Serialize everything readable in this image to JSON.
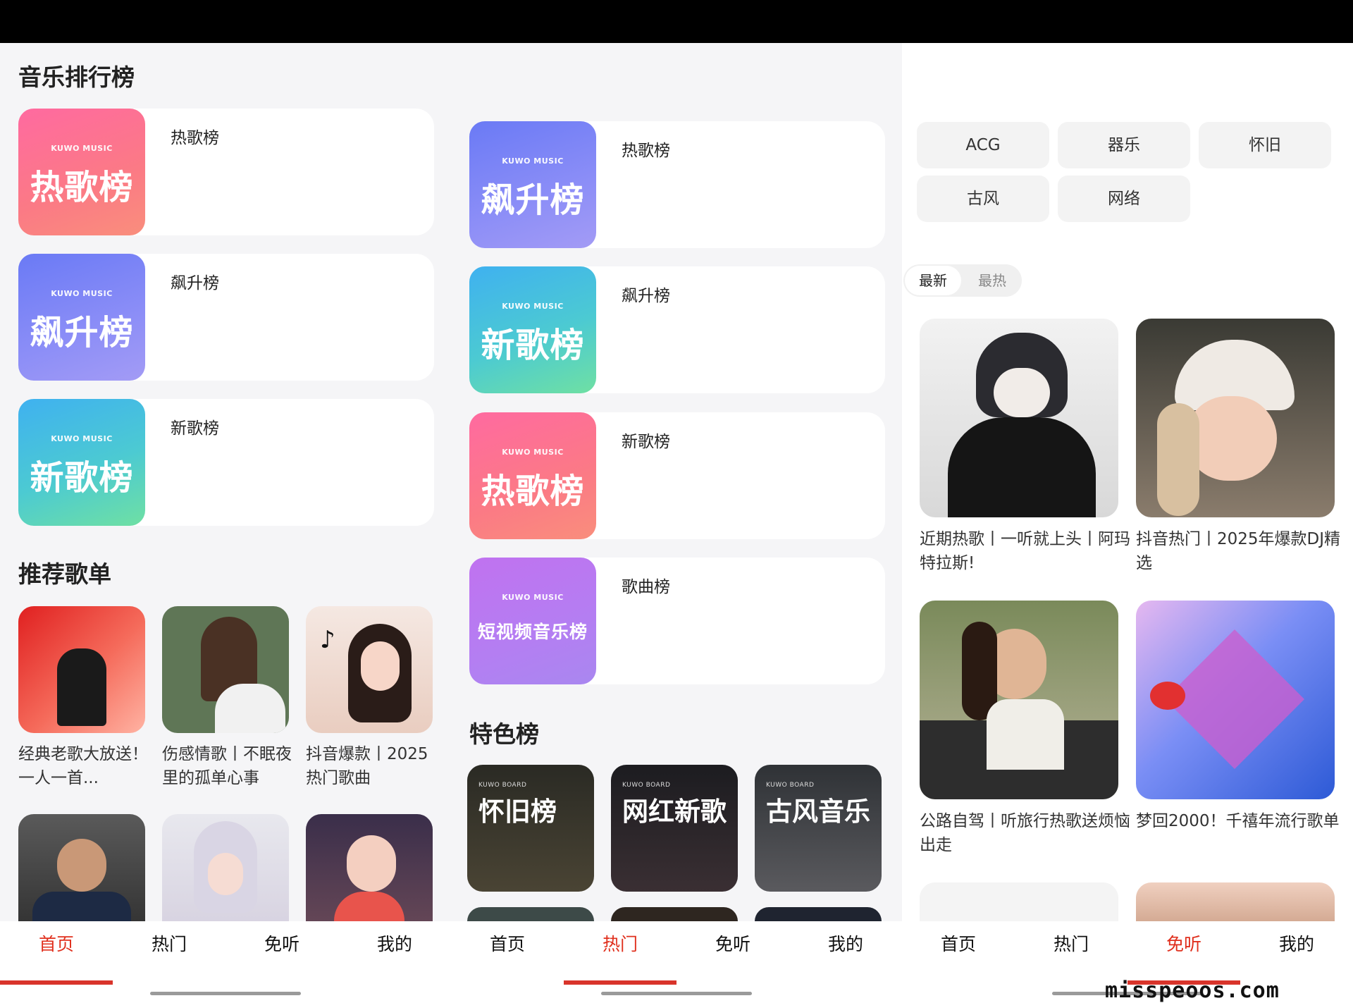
{
  "panel1": {
    "rank_title": "音乐排行榜",
    "rank_list": [
      {
        "label": "热歌榜",
        "cover_brand": "KUWO MUSIC",
        "cover_text": "热歌榜"
      },
      {
        "label": "飙升榜",
        "cover_brand": "KUWO MUSIC",
        "cover_text": "飙升榜"
      },
      {
        "label": "新歌榜",
        "cover_brand": "KUWO MUSIC",
        "cover_text": "新歌榜"
      }
    ],
    "rec_title": "推荐歌单",
    "rec_list": [
      {
        "caption": "经典老歌大放送！一人一首..."
      },
      {
        "caption": "伤感情歌丨不眠夜里的孤单心事"
      },
      {
        "caption": "抖音爆款丨2025热门歌曲"
      }
    ]
  },
  "panel2": {
    "rank_list": [
      {
        "label": "热歌榜",
        "cover_brand": "KUWO MUSIC",
        "cover_text": "飙升榜"
      },
      {
        "label": "飙升榜",
        "cover_brand": "KUWO MUSIC",
        "cover_text": "新歌榜"
      },
      {
        "label": "新歌榜",
        "cover_brand": "KUWO MUSIC",
        "cover_text": "热歌榜"
      },
      {
        "label": "歌曲榜",
        "cover_brand": "KUWO MUSIC",
        "cover_text": "短视频音乐榜"
      }
    ],
    "feature_title": "特色榜",
    "feature_list": [
      {
        "tag": "KUWO BOARD",
        "title": "怀旧榜"
      },
      {
        "tag": "KUWO BOARD",
        "title": "网红新歌"
      },
      {
        "tag": "KUWO BOARD",
        "title": "古风音乐"
      }
    ]
  },
  "panel3": {
    "chips": [
      "ACG",
      "器乐",
      "怀旧",
      "古风",
      "网络"
    ],
    "sort_tabs": {
      "newest": "最新",
      "hottest": "最热"
    },
    "playlists": [
      {
        "caption": "近期热歌丨一听就上头丨阿玛特拉斯!"
      },
      {
        "caption": "抖音热门丨2025年爆款DJ精选"
      },
      {
        "caption": "公路自驾丨听旅行热歌送烦恼出走"
      },
      {
        "caption": "梦回2000！千禧年流行歌单"
      }
    ]
  },
  "nav": {
    "home": "首页",
    "hot": "热门",
    "free": "免听",
    "mine": "我的"
  },
  "nav_active": {
    "panel1": "首页",
    "panel2": "热门",
    "panel3": "免听"
  },
  "watermark": "misspeoos.com",
  "colors": {
    "accent": "#d9342b",
    "active_text": "#e0301e"
  }
}
